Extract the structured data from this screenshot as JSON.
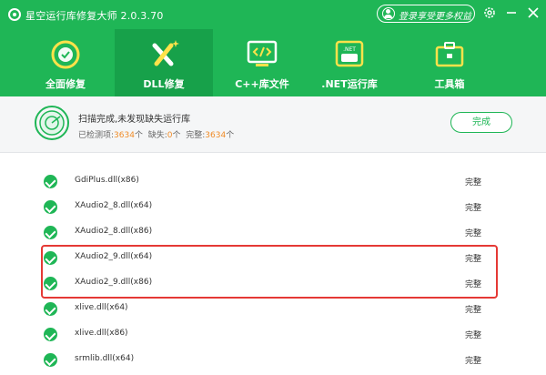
{
  "app": {
    "title": "星空运行库修复大师 2.0.3.70",
    "login_label": "登录享受更多权益"
  },
  "tabs": [
    {
      "label": "全面修复",
      "icon": "refresh-icon",
      "active": false
    },
    {
      "label": "DLL修复",
      "icon": "dll-repair-icon",
      "active": true
    },
    {
      "label": "C++库文件",
      "icon": "code-file-icon",
      "active": false
    },
    {
      "label": ".NET运行库",
      "icon": "net-runtime-icon",
      "active": false
    },
    {
      "label": "工具箱",
      "icon": "toolbox-icon",
      "active": false
    }
  ],
  "status": {
    "title": "扫描完成,未发现缺失运行库",
    "detected_label": "已检测项:",
    "detected_count": "3634",
    "missing_label": "缺失:",
    "missing_count": "0",
    "complete_label": "完整:",
    "complete_count": "3634",
    "unit": "个",
    "done_button": "完成"
  },
  "files": [
    {
      "name": "GdiPlus.dll(x86)",
      "status": "完整"
    },
    {
      "name": "XAudio2_8.dll(x64)",
      "status": "完整"
    },
    {
      "name": "XAudio2_8.dll(x86)",
      "status": "完整"
    },
    {
      "name": "XAudio2_9.dll(x64)",
      "status": "完整"
    },
    {
      "name": "XAudio2_9.dll(x86)",
      "status": "完整"
    },
    {
      "name": "xlive.dll(x64)",
      "status": "完整"
    },
    {
      "name": "xlive.dll(x86)",
      "status": "完整"
    },
    {
      "name": "srmlib.dll(x64)",
      "status": "完整"
    }
  ],
  "colors": {
    "brand_green": "#1fb656",
    "active_tab": "#17a14a",
    "highlight_red": "#e53935",
    "count_orange": "#f08c28"
  }
}
